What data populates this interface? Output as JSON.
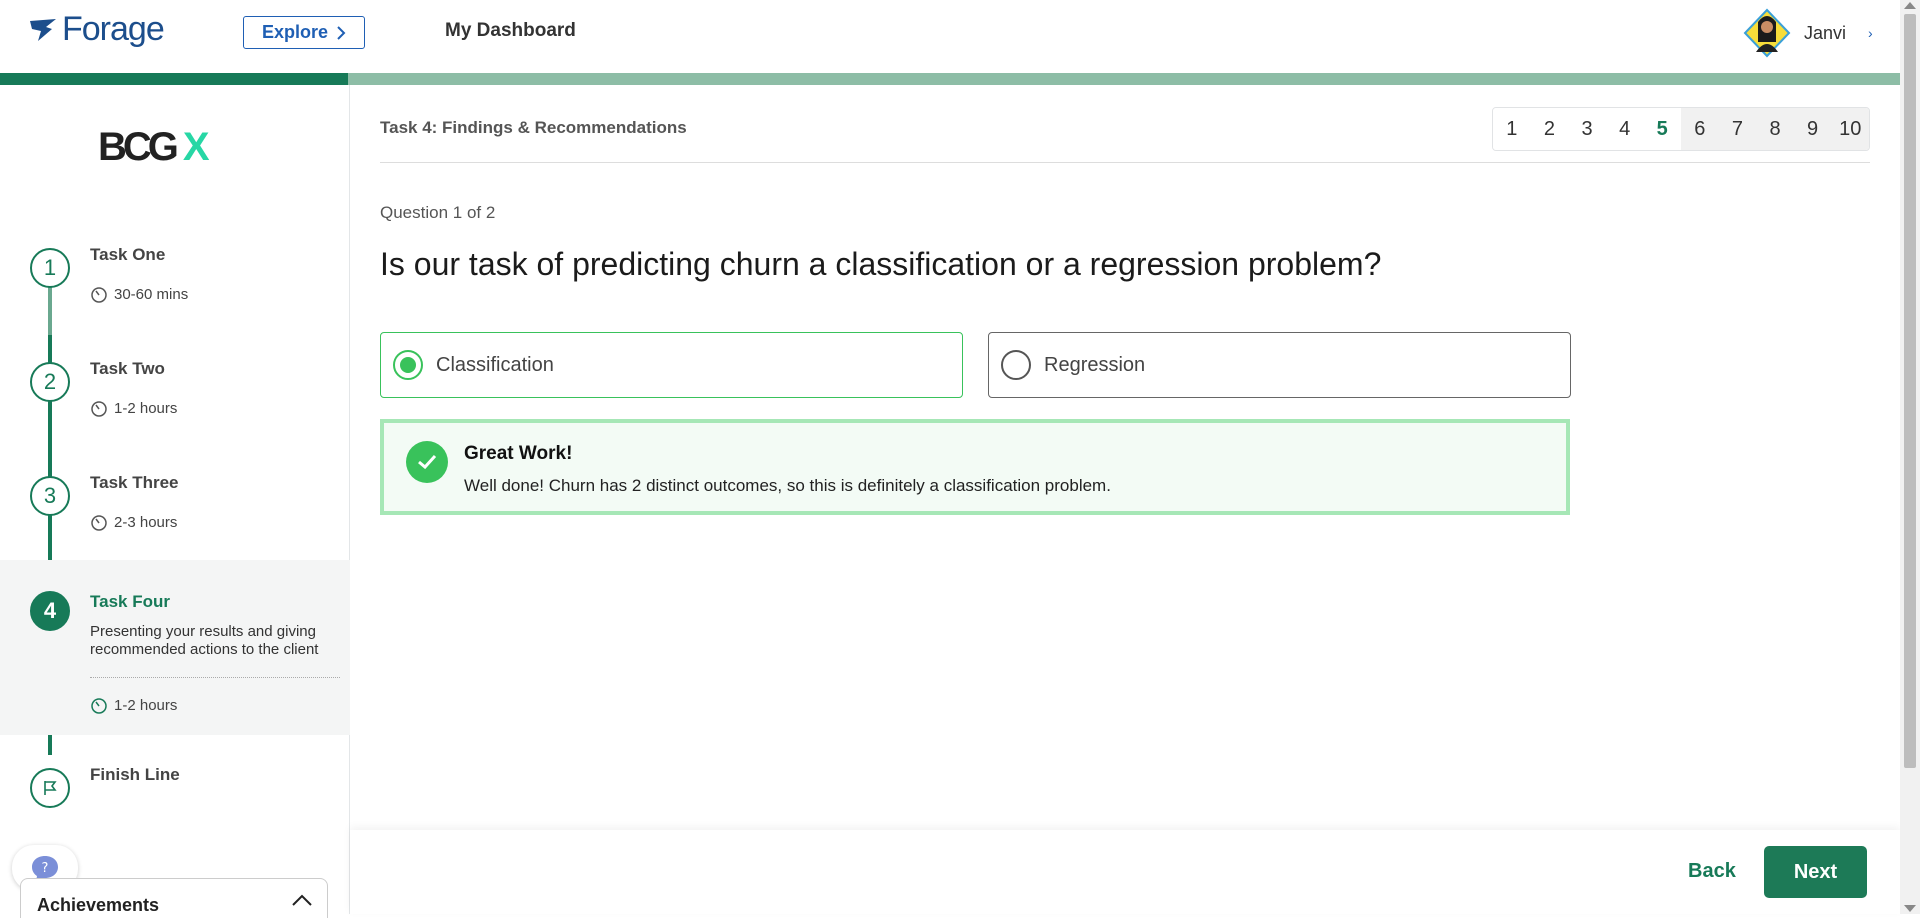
{
  "header": {
    "brand": "Forage",
    "explore_label": "Explore",
    "dashboard_label": "My Dashboard",
    "user_name": "Janvi",
    "progress_fraction": 0.183
  },
  "sidebar": {
    "company_logo_text": "BCG",
    "company_logo_mark": "X",
    "tasks": [
      {
        "number": "1",
        "title": "Task One",
        "time": "30-60 mins"
      },
      {
        "number": "2",
        "title": "Task Two",
        "time": "1-2 hours"
      },
      {
        "number": "3",
        "title": "Task Three",
        "time": "2-3 hours"
      },
      {
        "number": "4",
        "title": "Task Four",
        "description": "Presenting your results and giving recommended actions to the client",
        "time": "1-2 hours"
      }
    ],
    "finish_label": "Finish Line",
    "help_label": "?",
    "achievements_label": "Achievements"
  },
  "main": {
    "task_heading": "Task 4: Findings & Recommendations",
    "pages": [
      "1",
      "2",
      "3",
      "4",
      "5",
      "6",
      "7",
      "8",
      "9",
      "10"
    ],
    "current_page": "5",
    "question_count": "Question 1 of 2",
    "question": "Is our task of predicting churn a classification or a regression problem?",
    "options": [
      {
        "label": "Classification",
        "selected": true
      },
      {
        "label": "Regression",
        "selected": false
      }
    ],
    "feedback": {
      "title": "Great Work!",
      "text": "Well done! Churn has 2 distinct outcomes, so this is definitely a classification problem."
    }
  },
  "footer": {
    "back_label": "Back",
    "next_label": "Next"
  },
  "colors": {
    "brand_green": "#177a58",
    "success_green": "#39c25b",
    "forage_blue": "#1c4e8c"
  }
}
